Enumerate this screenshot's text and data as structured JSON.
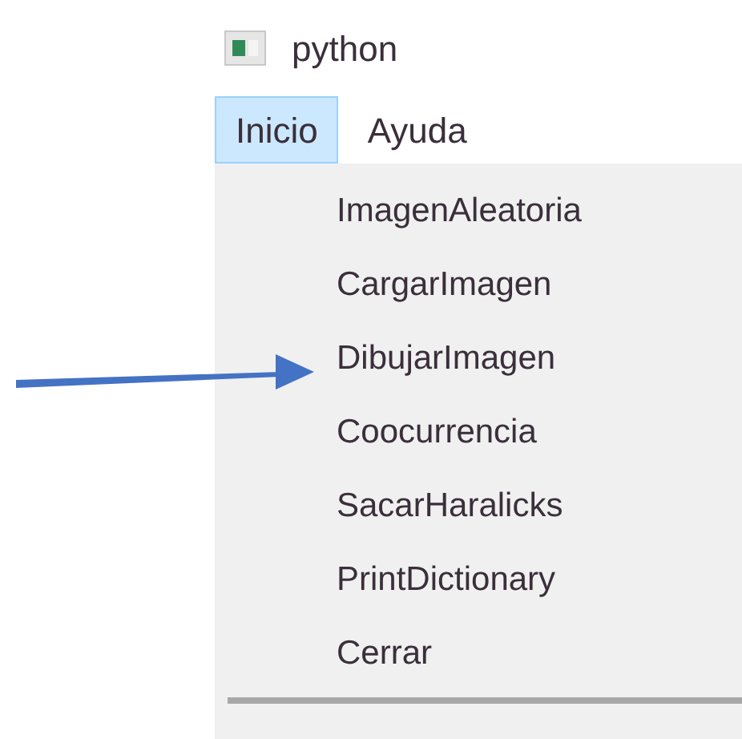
{
  "window": {
    "title": "python"
  },
  "menubar": [
    {
      "label": "Inicio",
      "selected": true
    },
    {
      "label": "Ayuda",
      "selected": false
    }
  ],
  "menu": {
    "items": [
      "ImagenAleatoria",
      "CargarImagen",
      "DibujarImagen",
      "Coocurrencia",
      "SacarHaralicks",
      "PrintDictionary",
      "Cerrar"
    ]
  }
}
